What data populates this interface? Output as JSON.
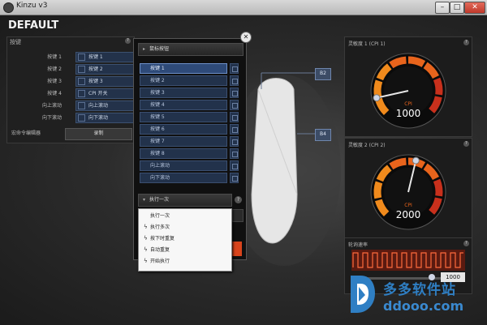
{
  "window": {
    "title": "Kinzu v3",
    "buttons": {
      "minimize": "–",
      "maximize": "□",
      "close": "✕"
    }
  },
  "profile_name": "DEFAULT",
  "buttons_panel": {
    "title": "按键",
    "help": "?",
    "rows": [
      {
        "name": "按键 1",
        "value": "按键 1"
      },
      {
        "name": "按键 2",
        "value": "按键 2"
      },
      {
        "name": "按键 3",
        "value": "按键 3"
      },
      {
        "name": "按键 4",
        "value": "CPI 开关"
      },
      {
        "name": "向上滚动",
        "value": "向上滚动"
      },
      {
        "name": "向下滚动",
        "value": "向下滚动"
      }
    ],
    "macro_label": "宏命令编辑器",
    "action_button": "录制"
  },
  "popup": {
    "close": "✕",
    "header": "鼠标按钮",
    "items": [
      "按键 1",
      "按键 2",
      "按键 3",
      "按键 4",
      "按键 5",
      "按键 6",
      "按键 7",
      "按键 8",
      "向上滚动",
      "向下滚动"
    ],
    "selected_index": 0,
    "exec_header": "执行一次",
    "exec_help": "?",
    "exec_menu": [
      "执行一次",
      "执行多次",
      "按下时重复",
      "自动重复",
      "开始执行"
    ]
  },
  "mouse": {
    "markers": [
      "B2",
      "B4"
    ]
  },
  "gauges": [
    {
      "title": "灵敏度 1 (CPI 1)",
      "help": "?",
      "unit": "CPI",
      "value": "1000",
      "needle_fraction": 0.12
    },
    {
      "title": "灵敏度 2 (CPI 2)",
      "help": "?",
      "unit": "CPI",
      "value": "2000",
      "needle_fraction": 0.55
    }
  ],
  "polling": {
    "title": "轮询速率",
    "help": "?",
    "value": "1000"
  },
  "watermark": {
    "title": "多多软件站",
    "url": "ddooo.com"
  },
  "colors": {
    "accent_blue": "#23324a",
    "gauge_orange": "#e8641c",
    "gauge_red": "#c8301c",
    "watermark": "#2f7fc4"
  }
}
